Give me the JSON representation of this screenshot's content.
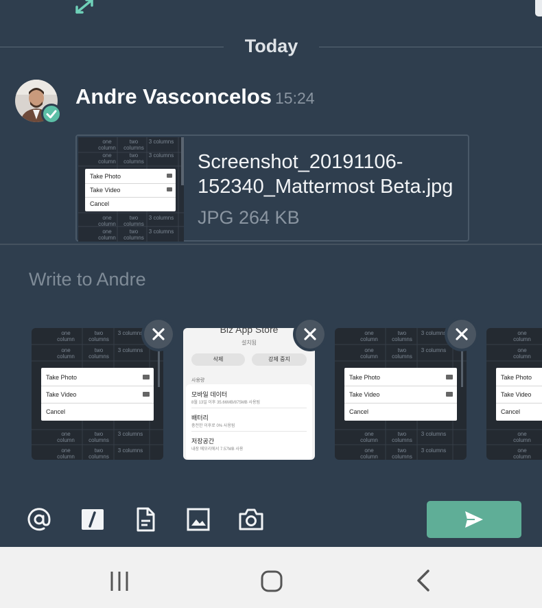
{
  "top": {
    "expand_icon": "expand-arrows-icon"
  },
  "date_separator": {
    "label": "Today"
  },
  "post": {
    "author": "Andre Vasconcelos",
    "time": "15:24",
    "avatar": "user-avatar",
    "status_icon": "checkmark-icon",
    "attachment": {
      "file_name": "Screenshot_20191106-152340_Mattermost Beta.jpg",
      "file_meta": "JPG 264 KB",
      "preview": {
        "grid": [
          [
            "one column",
            "two columns",
            "3 columns"
          ],
          [
            "one column",
            "two columns",
            "3 columns"
          ],
          [
            "one column",
            "two columns",
            "3 columns"
          ],
          [
            "one column",
            "two columns",
            "3 columns"
          ]
        ],
        "menu": [
          "Take Photo",
          "Take Video",
          "Cancel"
        ]
      }
    }
  },
  "composer": {
    "placeholder": "Write to Andre",
    "thumbnails": [
      {
        "kind": "menu-screenshot",
        "grid_top": [
          [
            "one column",
            "two columns",
            "3 columns"
          ],
          [
            "one column",
            "two columns",
            "3 columns"
          ]
        ],
        "grid_bottom": [
          [
            "one column",
            "two columns",
            "3 columns"
          ],
          [
            "one column",
            "two columns",
            "3 columns"
          ]
        ],
        "menu": [
          "Take Photo",
          "Take Video",
          "Cancel"
        ],
        "remove_icon": "close-icon"
      },
      {
        "kind": "app-settings-screenshot",
        "title": "Biz App Store",
        "subtitle": "설치됨",
        "buttons": [
          "삭제",
          "강제 중지"
        ],
        "section": "사용량",
        "items": [
          {
            "label": "모바일 데이터",
            "sub": "8월 13일 이후 35.66MB/875MB 사용됨"
          },
          {
            "label": "배터리",
            "sub": "충전한 이후로 0% 사용됨"
          },
          {
            "label": "저장공간",
            "sub": "내장 메모리에서 7.57MB 사용"
          }
        ],
        "remove_icon": "close-icon"
      },
      {
        "kind": "menu-screenshot",
        "grid_top": [
          [
            "one column",
            "two columns",
            "3 columns"
          ],
          [
            "one column",
            "two columns",
            "3 columns"
          ]
        ],
        "grid_bottom": [
          [
            "one column",
            "two columns",
            "3 columns"
          ],
          [
            "one column",
            "two columns",
            "3 columns"
          ]
        ],
        "menu": [
          "Take Photo",
          "Take Video",
          "Cancel"
        ],
        "remove_icon": "close-icon"
      },
      {
        "kind": "menu-screenshot-partial",
        "grid_top": [
          [
            "one column"
          ],
          [
            "one column"
          ]
        ],
        "grid_bottom": [
          [
            "one column"
          ],
          [
            "one column"
          ]
        ],
        "menu": [
          "Take Photo",
          "Take Video",
          "Cancel"
        ]
      }
    ]
  },
  "toolbar": {
    "icons": [
      "at-mention-icon",
      "slash-command-icon",
      "file-icon",
      "image-icon",
      "camera-icon"
    ],
    "send_icon": "send-icon"
  },
  "navbar": {
    "icons": [
      "recent-apps-icon",
      "home-icon",
      "back-icon"
    ]
  },
  "colors": {
    "background": "#2f3e4e",
    "accent": "#5fae97",
    "status": "#5cbfa6"
  }
}
